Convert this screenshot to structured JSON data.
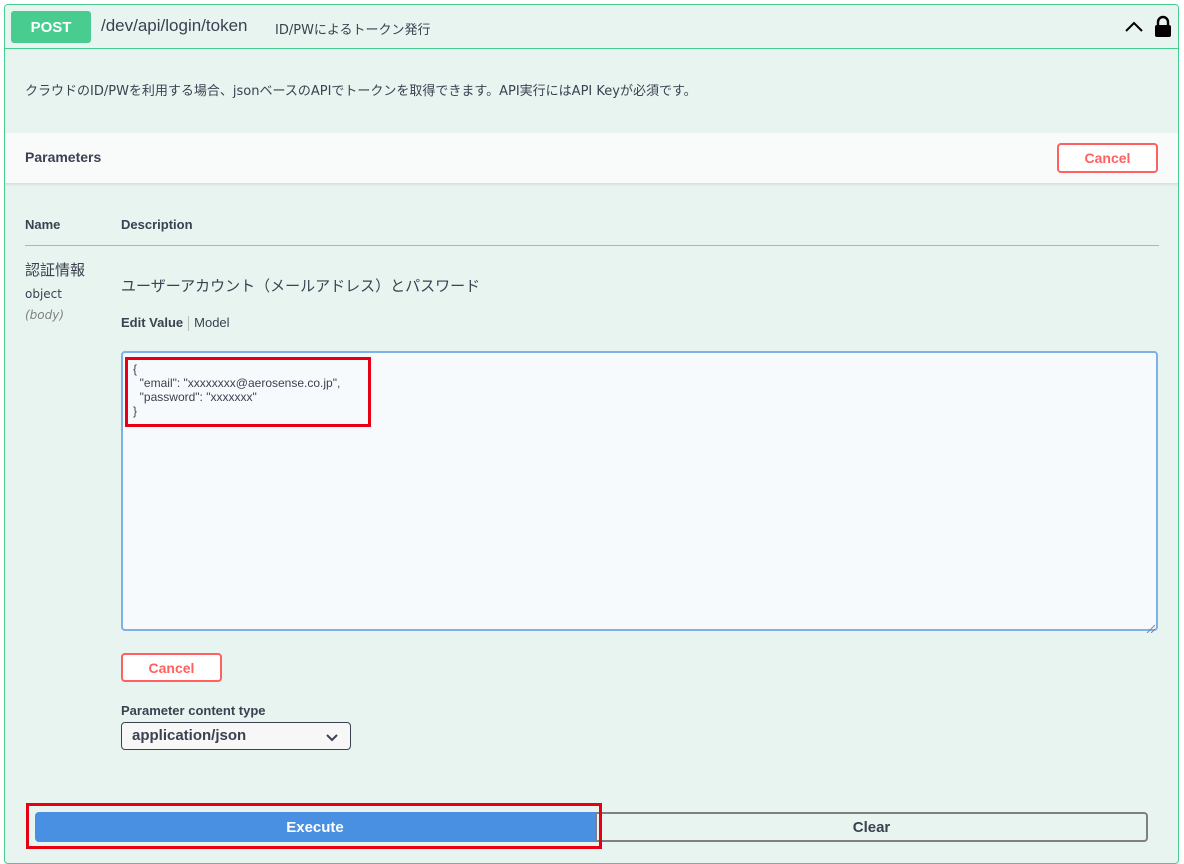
{
  "operation": {
    "method": "POST",
    "path": "/dev/api/login/token",
    "summary": "ID/PWによるトークン発行",
    "description": "クラウドのID/PWを利用する場合、jsonベースのAPIでトークンを取得できます。API実行にはAPI Keyが必須です。",
    "collapse_icon": "chevron-up-icon",
    "auth_icon": "lock-icon"
  },
  "parameters": {
    "title": "Parameters",
    "cancel_label": "Cancel",
    "columns": {
      "name": "Name",
      "description": "Description"
    },
    "items": [
      {
        "name": "認証情報",
        "type": "object",
        "in": "(body)",
        "description": "ユーザーアカウント（メールアドレス）とパスワード",
        "tabs": {
          "edit_value": "Edit Value",
          "model": "Model"
        },
        "value": "{\n  \"email\": \"xxxxxxxx@aerosense.co.jp\",\n  \"password\": \"xxxxxxx\"\n}"
      }
    ],
    "body_cancel_label": "Cancel",
    "content_type_label": "Parameter content type",
    "content_type_value": "application/json"
  },
  "actions": {
    "execute_label": "Execute",
    "clear_label": "Clear"
  },
  "colors": {
    "post_green": "#49cc90",
    "block_bg": "#e8f4ef",
    "cancel_red": "#ff6060",
    "execute_blue": "#4990e2",
    "annotation_red": "#e60012"
  }
}
